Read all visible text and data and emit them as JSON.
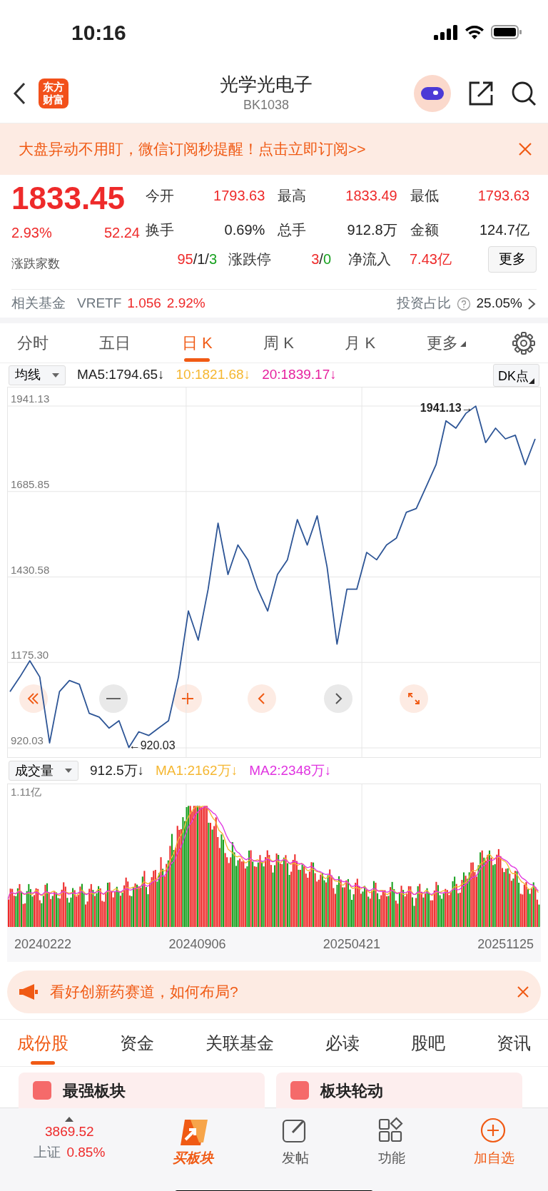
{
  "status_bar": {
    "time": "10:16"
  },
  "header": {
    "logo": [
      "东方",
      "财富"
    ],
    "title": "光学光电子",
    "code": "BK1038"
  },
  "alert_banner": {
    "text": "大盘异动不用盯，微信订阅秒提醒！点击立即订阅>>"
  },
  "quote": {
    "price": "1833.45",
    "change_pct": "2.93%",
    "change": "52.24",
    "stats": [
      {
        "label": "今开",
        "value": "1793.63",
        "color": "#ee2a2a"
      },
      {
        "label": "最高",
        "value": "1833.49",
        "color": "#ee2a2a"
      },
      {
        "label": "最低",
        "value": "1793.63",
        "color": "#ee2a2a"
      },
      {
        "label": "换手",
        "value": "0.69%",
        "color": "#222222"
      },
      {
        "label": "总手",
        "value": "912.8万",
        "color": "#222222"
      },
      {
        "label": "金额",
        "value": "124.7亿",
        "color": "#222222"
      }
    ],
    "breadth_label": "涨跌家数",
    "breadth": [
      {
        "text": "95",
        "color": "#ee2a2a"
      },
      {
        "text": "/",
        "color": "#222222"
      },
      {
        "text": "1",
        "color": "#222222"
      },
      {
        "text": "/",
        "color": "#222222"
      },
      {
        "text": "3",
        "color": "#17a11f"
      }
    ],
    "limit_label": "涨跌停",
    "limit": [
      {
        "text": "3",
        "color": "#ee2a2a"
      },
      {
        "text": "/",
        "color": "#222222"
      },
      {
        "text": "0",
        "color": "#17a11f"
      }
    ],
    "inflow_label": "净流入",
    "inflow": "7.43亿",
    "more_button": "更多"
  },
  "fund": {
    "label": "相关基金",
    "code": "VRETF",
    "price": "1.056",
    "change": "2.92%",
    "ratio_label": "投资占比",
    "ratio": "25.05%"
  },
  "chart_tabs": [
    {
      "label": "分时",
      "selected": false,
      "kind": "plain"
    },
    {
      "label": "五日",
      "selected": false,
      "kind": "plain"
    },
    {
      "label": "日 K",
      "selected": true,
      "kind": "plain"
    },
    {
      "label": "周 K",
      "selected": false,
      "kind": "plain"
    },
    {
      "label": "月 K",
      "selected": false,
      "kind": "plain"
    },
    {
      "label": "更多",
      "selected": false,
      "kind": "dropdown"
    }
  ],
  "ma_legend": {
    "selector": "均线",
    "items": [
      {
        "text": "MA5:1794.65↓",
        "color": "#222222"
      },
      {
        "text": "10:1821.68↓",
        "color": "#f5b731"
      },
      {
        "text": "20:1839.17↓",
        "color": "#e6209e"
      }
    ],
    "dk_button": "DK点"
  },
  "price_chart": {
    "chart_data": {
      "type": "line",
      "grid": true,
      "ylim": [
        920.03,
        1941.13
      ],
      "yticks": [
        {
          "value": 1941.13,
          "label": "1941.13"
        },
        {
          "value": 1685.85,
          "label": "1685.85"
        },
        {
          "value": 1430.58,
          "label": "1430.58"
        },
        {
          "value": 1175.3,
          "label": "1175.30"
        },
        {
          "value": 920.03,
          "label": "920.03"
        }
      ],
      "series": [
        {
          "color": "#2d5596",
          "values": [
            1088,
            1132,
            1180,
            1132,
            935,
            1088,
            1121,
            1110,
            1023,
            1012,
            979,
            1001,
            921,
            968,
            957,
            979,
            1001,
            1132,
            1329,
            1242,
            1394,
            1591,
            1438,
            1526,
            1482,
            1394,
            1329,
            1438,
            1482,
            1602,
            1526,
            1613,
            1460,
            1230,
            1394,
            1394,
            1504,
            1482,
            1526,
            1547,
            1624,
            1635,
            1700,
            1766,
            1897,
            1875,
            1919,
            1941,
            1832,
            1875,
            1843,
            1854,
            1766,
            1843
          ]
        }
      ],
      "annotations": [
        "1941.13→",
        "←920.03"
      ]
    }
  },
  "volume_legend": {
    "selector": "成交量",
    "items": [
      {
        "text": "912.5万↓",
        "color": "#222222"
      },
      {
        "text": "MA1:2162万↓",
        "color": "#f5b731"
      },
      {
        "text": "MA2:2348万↓",
        "color": "#e033e0"
      }
    ]
  },
  "volume_chart": {
    "max_label": "1.11亿"
  },
  "dates": [
    "20240222",
    "20240906",
    "20250421",
    "20251125"
  ],
  "ad_banner": {
    "text": "看好创新药赛道，如何布局?"
  },
  "section_tabs": [
    {
      "label": "成份股",
      "selected": true
    },
    {
      "label": "资金",
      "selected": false
    },
    {
      "label": "关联基金",
      "selected": false
    },
    {
      "label": "必读",
      "selected": false
    },
    {
      "label": "股吧",
      "selected": false
    },
    {
      "label": "资讯",
      "selected": false
    }
  ],
  "cards": [
    "最强板块",
    "板块轮动"
  ],
  "bottom_nav": {
    "index": {
      "value": "3869.52",
      "name": "上证",
      "change": "0.85%"
    },
    "items": [
      {
        "label": "买板块",
        "kind": "brand"
      },
      {
        "label": "发帖",
        "kind": "post"
      },
      {
        "label": "功能",
        "kind": "apps"
      },
      {
        "label": "加自选",
        "kind": "add"
      }
    ]
  }
}
